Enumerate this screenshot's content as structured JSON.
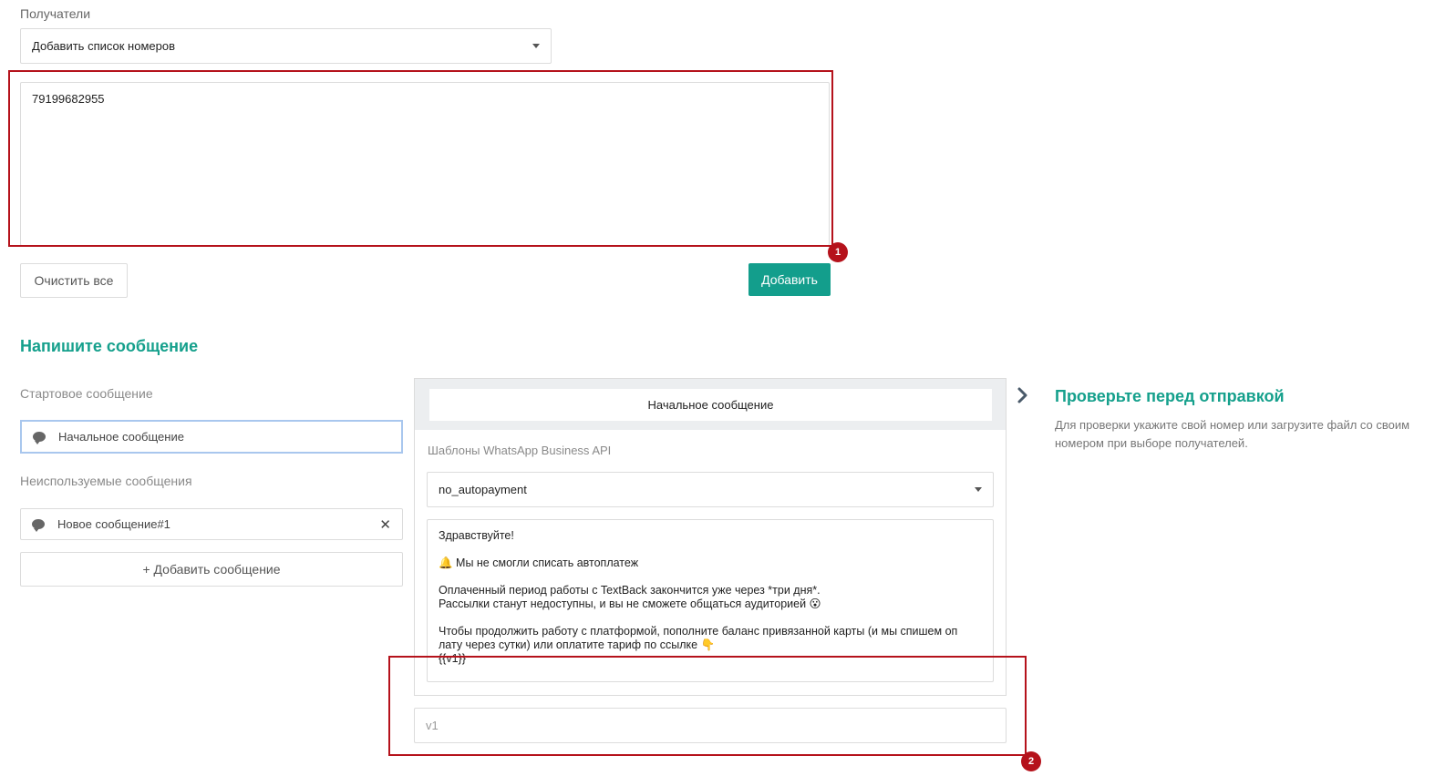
{
  "recipients": {
    "label": "Получатели",
    "select_value": "Добавить список номеров",
    "numbers_value": "79199682955",
    "clear_label": "Очистить все",
    "add_label": "Добавить"
  },
  "compose": {
    "title": "Напишите сообщение",
    "start_label": "Стартовое сообщение",
    "start_item": "Начальное сообщение",
    "unused_label": "Неиспользуемые сообщения",
    "unused_item": "Новое сообщение#1",
    "add_message_label": "+ Добавить сообщение"
  },
  "editor": {
    "tab_label": "Начальное сообщение",
    "templates_label": "Шаблоны WhatsApp Business API",
    "template_value": "no_autopayment",
    "lines": [
      "Здравствуйте!",
      "🔔 Мы не смогли списать автоплатеж",
      "Оплаченный период работы с TextBack закончится уже через *три дня*.\nРассылки станут недоступны, и вы не сможете общаться аудиторией 😮",
      "Чтобы продолжить работу с платформой, пополните баланс привязанной карты (и мы спишем оп\nлату через сутки) или оплатите тариф по ссылке 👇\n{{v1}}"
    ],
    "var_placeholder": "v1"
  },
  "preview": {
    "title": "Проверьте перед отправкой",
    "description": "Для проверки укажите свой номер или загрузите файл со своим\nномером при выборе получателей."
  },
  "badges": {
    "one": "1",
    "two": "2"
  },
  "colors": {
    "accent": "#15a08c",
    "button": "#139e8c",
    "annotation": "#b5121b"
  }
}
